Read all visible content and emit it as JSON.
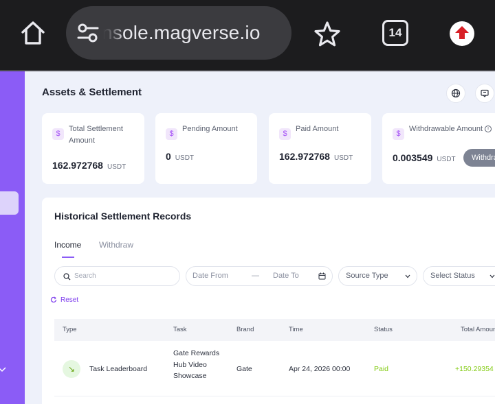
{
  "browser": {
    "url": "console.magverse.io",
    "tab_count": "14"
  },
  "page": {
    "title": "Assets & Settlement"
  },
  "cards": [
    {
      "label": "Total Settlement Amount",
      "value": "162.972768",
      "unit": "USDT"
    },
    {
      "label": "Pending Amount",
      "value": "0",
      "unit": "USDT"
    },
    {
      "label": "Paid Amount",
      "value": "162.972768",
      "unit": "USDT"
    },
    {
      "label": "Withdrawable Amount",
      "value": "0.003549",
      "unit": "USDT",
      "button": "Withdraw"
    }
  ],
  "records": {
    "title": "Historical Settlement Records",
    "tabs": [
      "Income",
      "Withdraw"
    ],
    "active_tab": "Income",
    "filters": {
      "search_placeholder": "Search",
      "date_from": "Date From",
      "date_sep": "—",
      "date_to": "Date To",
      "source_type": "Source Type",
      "status": "Select Status",
      "reset": "Reset"
    },
    "columns": [
      "Type",
      "Task",
      "Brand",
      "Time",
      "Status",
      "Total Amount"
    ],
    "rows": [
      {
        "type": "Task Leaderboard",
        "task": "Gate Rewards Hub Video Showcase",
        "brand": "Gate",
        "time": "Apr 24, 2026 00:00",
        "status": "Paid",
        "amount": "+150.29354"
      }
    ]
  },
  "colors": {
    "accent": "#8b5cf6",
    "paid": "#84cc16",
    "chrome_bg": "#1c1c1e"
  }
}
